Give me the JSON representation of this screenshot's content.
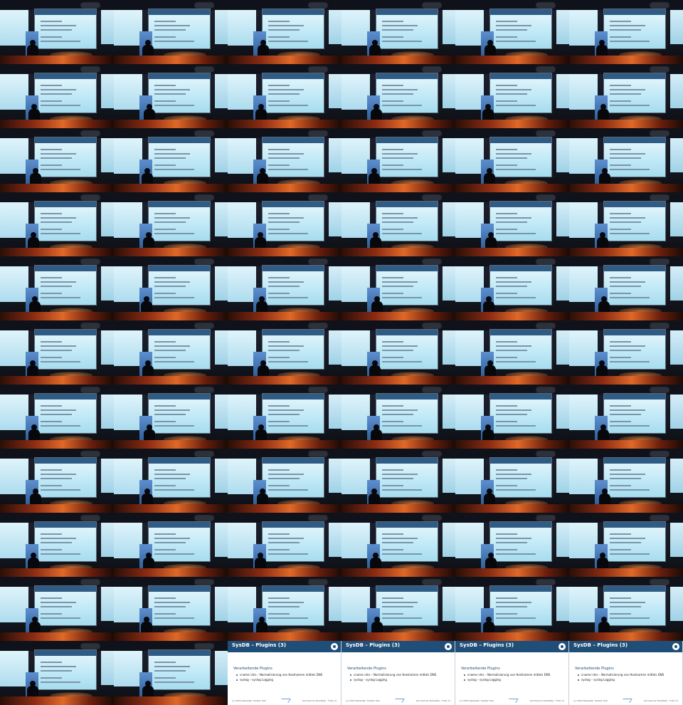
{
  "grid": {
    "columns": 6,
    "rows": 11
  },
  "tiles": [
    "photo",
    "photo",
    "photo",
    "photo",
    "photo",
    "photo",
    "photo",
    "photo",
    "photo",
    "photo",
    "photo",
    "photo",
    "photo",
    "photo",
    "photo",
    "photo",
    "photo",
    "photo",
    "photo",
    "photo",
    "photo",
    "photo",
    "photo",
    "photo",
    "photo",
    "photo",
    "photo",
    "photo",
    "photo",
    "photo",
    "photo",
    "photo",
    "photo",
    "photo",
    "photo",
    "photo",
    "photo",
    "photo",
    "photo",
    "photo",
    "photo",
    "photo",
    "photo",
    "photo",
    "photo",
    "photo",
    "photo",
    "photo",
    "photo",
    "photo",
    "photo",
    "photo",
    "photo",
    "photo",
    "photo",
    "photo",
    "photo",
    "photo",
    "photo",
    "photo",
    "photo",
    "photo",
    "slide",
    "slide",
    "slide",
    "slide"
  ],
  "slide": {
    "title": "SysDB – Plugins (3)",
    "subtitle": "Verarbeitende Plugins",
    "bullet_1": "cname::dns – Normalisierung von Hostnamen mittels DNS",
    "bullet_2": "syslog – syslog Logging",
    "footer_left": "(c) 2016 Sebastian 'tokkee' Harl",
    "footer_right": "Gut Serious ToolsData – Folie 11"
  },
  "colors": {
    "slide_header": "#1f4e79",
    "stage_orange": "#e06828",
    "screen_cyan": "#bfe8f6"
  }
}
